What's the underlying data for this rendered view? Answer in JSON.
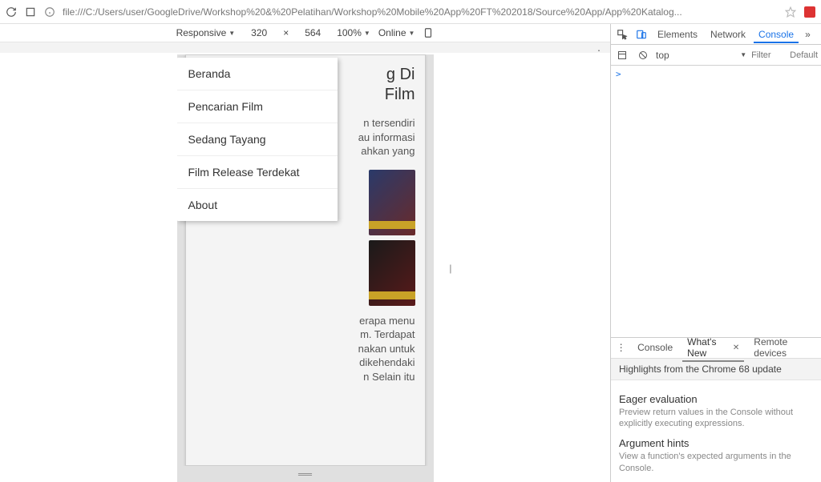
{
  "browser": {
    "url_text": "file:///C:/Users/user/GoogleDrive/Workshop%20&%20Pelatihan/Workshop%20Mobile%20App%20FT%202018/Source%20App/App%20Katalog..."
  },
  "device_toolbar": {
    "responsive_label": "Responsive",
    "width": "320",
    "height": "564",
    "zoom": "100%",
    "throttle": "Online"
  },
  "menu": {
    "items": [
      "Beranda",
      "Pencarian Film",
      "Sedang Tayang",
      "Film Release Terdekat",
      "About"
    ]
  },
  "app": {
    "heading_line1": "g Di",
    "heading_line2": "Film",
    "para1_a": "n tersendiri",
    "para1_b": "au informasi",
    "para1_c": "ahkan yang",
    "para2_a": "erapa menu",
    "para2_b": "m. Terdapat",
    "para2_c": "nakan untuk",
    "para2_d": "dikehendaki",
    "para2_e": "n Selain itu"
  },
  "devtools": {
    "tabs": {
      "elements": "Elements",
      "network": "Network",
      "console": "Console"
    },
    "context": "top",
    "filter_placeholder": "Filter",
    "level": "Default",
    "prompt": ">",
    "drawer": {
      "console": "Console",
      "whatsnew": "What's New",
      "remote": "Remote devices",
      "highlights": "Highlights from the Chrome 68 update",
      "section1": {
        "title": "Eager evaluation",
        "desc": "Preview return values in the Console without explicitly executing expressions."
      },
      "section2": {
        "title": "Argument hints",
        "desc": "View a function's expected arguments in the Console."
      }
    }
  }
}
